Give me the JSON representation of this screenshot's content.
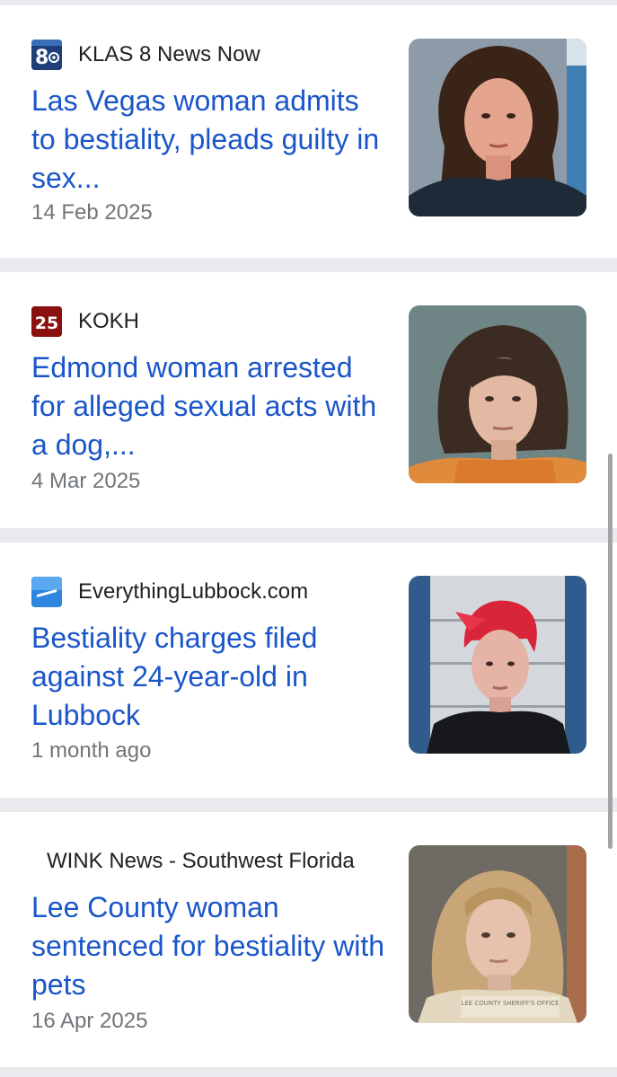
{
  "articles": [
    {
      "source": "KLAS 8 News Now",
      "source_icon": "klas-8-logo-icon",
      "headline": "Las Vegas woman admits to bestiality, pleads guilty in sex...",
      "date": "14 Feb 2025",
      "thumbnail": "mugshot-photo"
    },
    {
      "source": "KOKH",
      "source_icon": "kokh-25-logo-icon",
      "headline": "Edmond woman arrested for alleged sexual acts with a dog,...",
      "date": "4 Mar 2025",
      "thumbnail": "mugshot-photo"
    },
    {
      "source": "EverythingLubbock.com",
      "source_icon": "everythinglubbock-logo-icon",
      "headline": "Bestiality charges filed against 24-year-old in Lubbock",
      "date": "1 month ago",
      "thumbnail": "mugshot-photo"
    },
    {
      "source": "WINK News - Southwest Florida",
      "source_icon": "",
      "headline": "Lee County woman sentenced for bestiality with pets",
      "date": "16 Apr 2025",
      "thumbnail": "mugshot-photo",
      "thumbnail_caption": "LEE COUNTY SHERIFF'S OFFICE"
    }
  ],
  "logos": {
    "klas": "8",
    "kokh": "25"
  },
  "colors": {
    "headline": "#1a56c9",
    "source_text": "#202124",
    "date_text": "#70757a",
    "separator": "#e8eaed",
    "klas_logo_bg": "#1f3f7a",
    "kokh_logo_bg": "#8b1111",
    "everythinglubbock_logo_bg": "#2e86de"
  }
}
